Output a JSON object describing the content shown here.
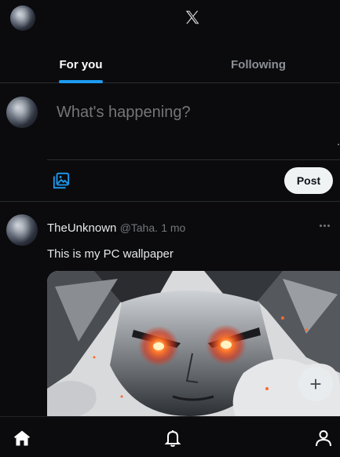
{
  "header": {
    "logo_icon": "x-logo-icon",
    "avatar_icon": "avatar"
  },
  "tabs": [
    {
      "label": "For you",
      "active": true
    },
    {
      "label": "Following",
      "active": false
    }
  ],
  "composer": {
    "placeholder": "What's happening?",
    "media_icon": "image-icon",
    "post_label": "Post"
  },
  "tweet": {
    "display_name": "TheUnknown",
    "handle": "@Taha",
    "separator": ".",
    "time": "1 mo",
    "text": "This is my PC wallpaper",
    "more_icon": "more-icon"
  },
  "fab": {
    "label": "+"
  },
  "bottom_nav": [
    {
      "icon": "home-icon"
    },
    {
      "icon": "bell-icon"
    },
    {
      "icon": "user-icon"
    }
  ],
  "colors": {
    "background": "#0b0b0d",
    "accent": "#1d9bf0",
    "muted": "#71767b"
  }
}
